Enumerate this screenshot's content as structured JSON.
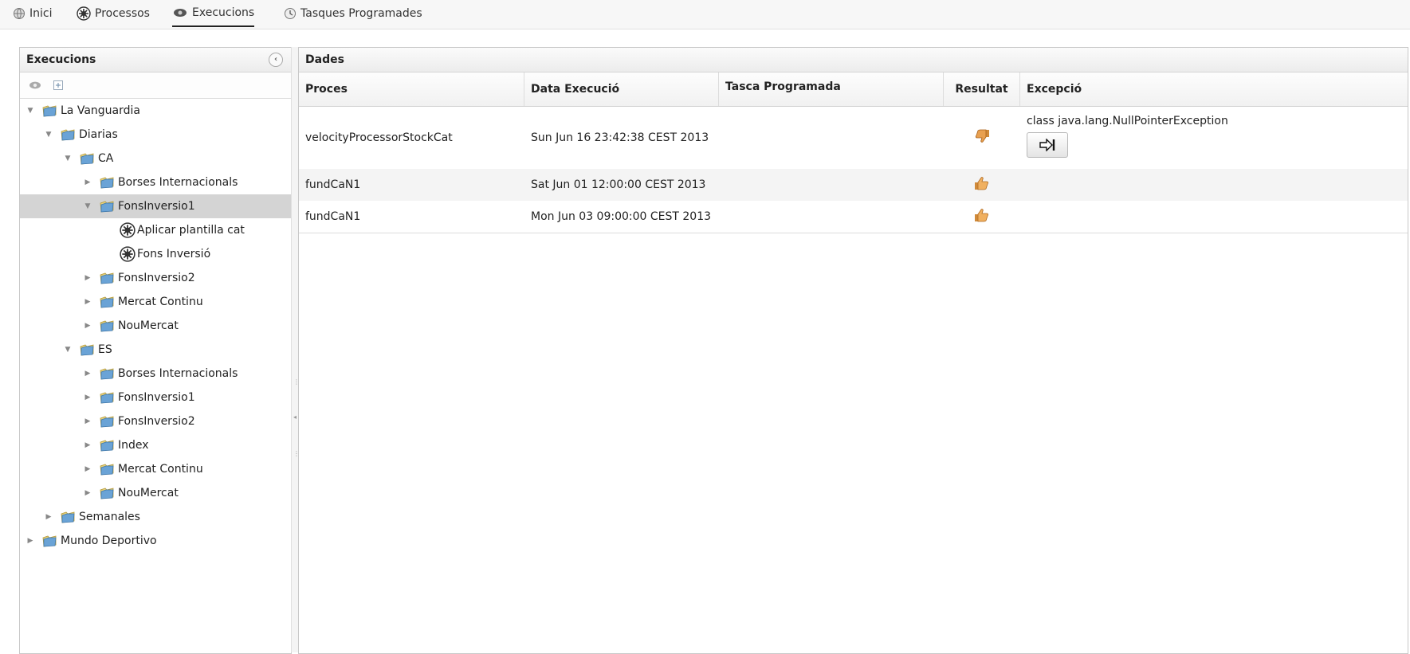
{
  "menu": {
    "items": [
      {
        "label": "Inici",
        "icon": "globe-icon"
      },
      {
        "label": "Processos",
        "icon": "gear-icon"
      },
      {
        "label": "Execucions",
        "icon": "run-icon",
        "active": true
      },
      {
        "label": "Tasques Programades",
        "icon": "clock-icon"
      }
    ]
  },
  "left_panel": {
    "title": "Execucions",
    "toolbar": [
      "run-icon",
      "expand-all-icon"
    ],
    "tree": [
      {
        "label": "La Vanguardia",
        "level": 0,
        "expanded": true,
        "type": "folder"
      },
      {
        "label": "Diarias",
        "level": 1,
        "expanded": true,
        "type": "folder"
      },
      {
        "label": "CA",
        "level": 2,
        "expanded": true,
        "type": "folder"
      },
      {
        "label": "Borses Internacionals",
        "level": 3,
        "expanded": false,
        "type": "folder"
      },
      {
        "label": "FonsInversio1",
        "level": 3,
        "expanded": true,
        "type": "folder",
        "selected": true
      },
      {
        "label": "Aplicar plantilla cat",
        "level": 4,
        "type": "process"
      },
      {
        "label": "Fons Inversió",
        "level": 4,
        "type": "process"
      },
      {
        "label": "FonsInversio2",
        "level": 3,
        "expanded": false,
        "type": "folder"
      },
      {
        "label": "Mercat Continu",
        "level": 3,
        "expanded": false,
        "type": "folder"
      },
      {
        "label": "NouMercat",
        "level": 3,
        "expanded": false,
        "type": "folder"
      },
      {
        "label": "ES",
        "level": 2,
        "expanded": true,
        "type": "folder"
      },
      {
        "label": "Borses Internacionals",
        "level": 3,
        "expanded": false,
        "type": "folder"
      },
      {
        "label": "FonsInversio1",
        "level": 3,
        "expanded": false,
        "type": "folder"
      },
      {
        "label": "FonsInversio2",
        "level": 3,
        "expanded": false,
        "type": "folder"
      },
      {
        "label": "Index",
        "level": 3,
        "expanded": false,
        "type": "folder"
      },
      {
        "label": "Mercat Continu",
        "level": 3,
        "expanded": false,
        "type": "folder"
      },
      {
        "label": "NouMercat",
        "level": 3,
        "expanded": false,
        "type": "folder"
      },
      {
        "label": "Semanales",
        "level": 1,
        "expanded": false,
        "type": "folder"
      },
      {
        "label": "Mundo Deportivo",
        "level": 0,
        "expanded": false,
        "type": "folder"
      }
    ]
  },
  "right_panel": {
    "title": "Dades",
    "columns": [
      "Proces",
      "Data Execució",
      "Tasca Programada",
      "Resultat",
      "Excepció"
    ],
    "rows": [
      {
        "proces": "velocityProcessorStockCat",
        "data": "Sun Jun 16 23:42:38 CEST 2013",
        "tasca": "",
        "resultat": "thumbs-down-icon",
        "excepcio": "class java.lang.NullPointerException",
        "has_button": true
      },
      {
        "proces": "fundCaN1",
        "data": "Sat Jun 01 12:00:00 CEST 2013",
        "tasca": "",
        "resultat": "thumbs-up-icon",
        "excepcio": "",
        "has_button": false
      },
      {
        "proces": "fundCaN1",
        "data": "Mon Jun 03 09:00:00 CEST 2013",
        "tasca": "",
        "resultat": "thumbs-up-icon",
        "excepcio": "",
        "has_button": false
      }
    ]
  }
}
